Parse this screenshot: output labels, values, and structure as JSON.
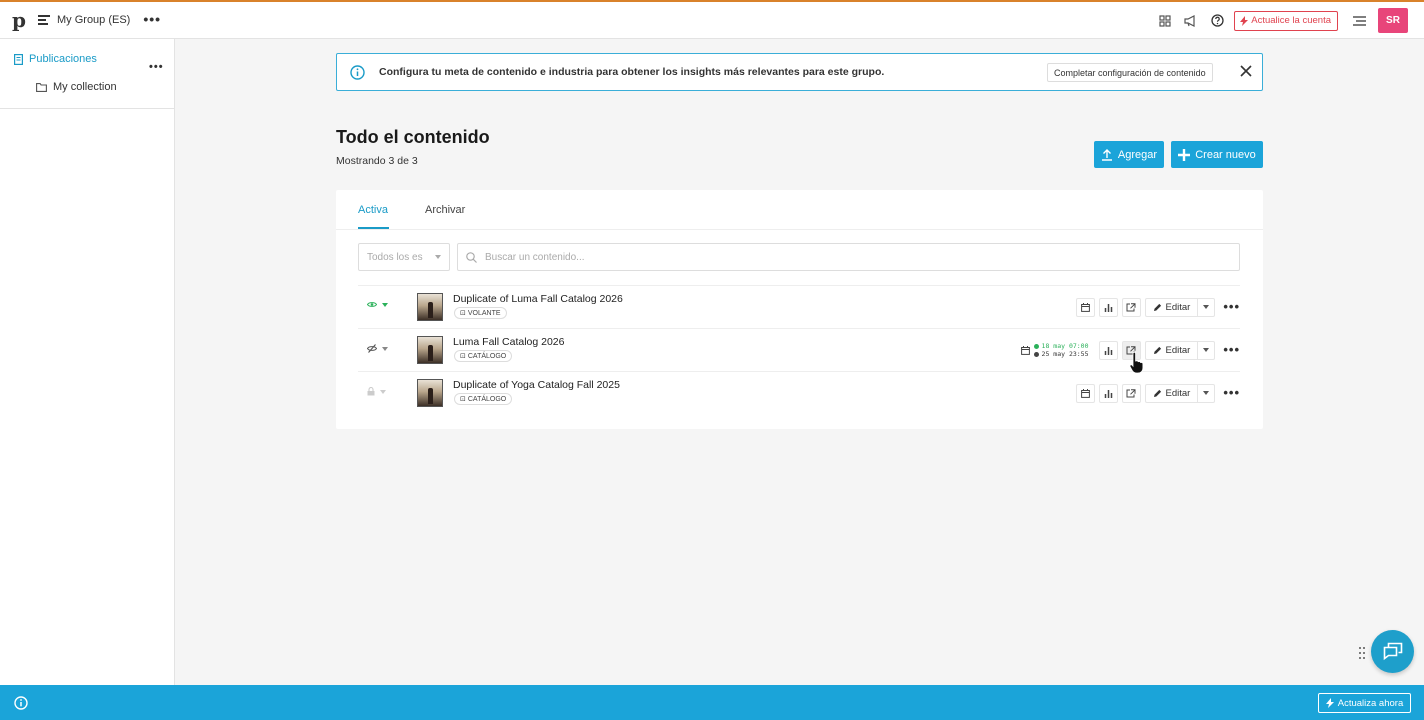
{
  "topbar": {
    "logo": "p",
    "group_name": "My Group (ES)",
    "upgrade_label": "Actualice la cuenta",
    "avatar_initials": "SR",
    "colors": {
      "brand": "#1ba4d9",
      "upgrade": "#e0434f",
      "avatar": "#e8457a",
      "top_accent": "#d9822b"
    }
  },
  "sidebar": {
    "publications_label": "Publicaciones",
    "items": [
      {
        "label": "My collection",
        "icon": "folder-icon"
      }
    ]
  },
  "banner": {
    "text": "Configura tu meta de contenido e industria para obtener los insights más relevantes para este grupo.",
    "button_label": "Completar configuración de contenido"
  },
  "main": {
    "title": "Todo el contenido",
    "count_text": "Mostrando 3 de 3",
    "add_label": "Agregar",
    "create_label": "Crear nuevo"
  },
  "tabs": [
    {
      "label": "Activa",
      "active": true
    },
    {
      "label": "Archivar",
      "active": false
    }
  ],
  "filter": {
    "selected": "Todos los es"
  },
  "search": {
    "placeholder": "Buscar un contenido...",
    "value": ""
  },
  "rows": [
    {
      "title": "Duplicate of Luma Fall Catalog 2026",
      "tag": "VOLANTE",
      "visibility": "visible-eye-icon",
      "edit_label": "Editar"
    },
    {
      "title": "Luma Fall Catalog 2026",
      "tag": "CATÁLOGO",
      "visibility": "hidden-eye-icon",
      "edit_label": "Editar",
      "schedule_start": "18 may 07:00",
      "schedule_end": "25 may 23:55"
    },
    {
      "title": "Duplicate of Yoga Catalog Fall 2025",
      "tag": "CATÁLOGO",
      "visibility": "lock-icon",
      "edit_label": "Editar"
    }
  ],
  "bottombar": {
    "button_label": "Actualiza ahora"
  }
}
